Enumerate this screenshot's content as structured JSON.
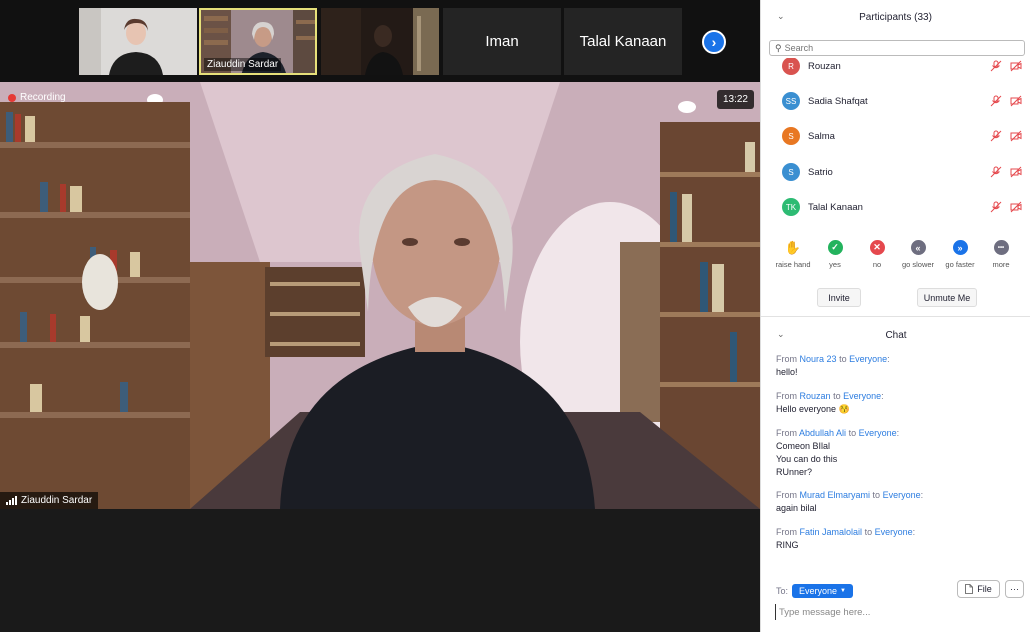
{
  "thumbnails": [
    {
      "name": "",
      "kind": "video-woman"
    },
    {
      "name": "Ziauddin Sardar",
      "kind": "video-man"
    },
    {
      "name": "",
      "kind": "video-dark"
    },
    {
      "name": "Iman",
      "kind": "name-only"
    },
    {
      "name": "Talal Kanaan",
      "kind": "name-only"
    }
  ],
  "main_video": {
    "recording_label": "Recording",
    "timer": "13:22",
    "speaker_name": "Ziauddin Sardar"
  },
  "participants": {
    "title": "Participants (33)",
    "search_placeholder": "Search",
    "items": [
      {
        "initials": "R",
        "name": "Rouzan",
        "color": "#d9534f"
      },
      {
        "initials": "SS",
        "name": "Sadia Shafqat",
        "color": "#3a8fd1"
      },
      {
        "initials": "S",
        "name": "Salma",
        "color": "#e87722"
      },
      {
        "initials": "S",
        "name": "Satrio",
        "color": "#3a8fd1"
      },
      {
        "initials": "TK",
        "name": "Talal Kanaan",
        "color": "#2dbb73"
      }
    ],
    "reactions": [
      {
        "label": "raise hand",
        "symbol": "✋",
        "color": "#1a73e8"
      },
      {
        "label": "yes",
        "symbol": "✓",
        "color": "#23b35d"
      },
      {
        "label": "no",
        "symbol": "✕",
        "color": "#e5484d"
      },
      {
        "label": "go slower",
        "symbol": "«",
        "color": "#6e6e80"
      },
      {
        "label": "go faster",
        "symbol": "»",
        "color": "#1a73e8"
      },
      {
        "label": "more",
        "symbol": "•••",
        "color": "#6e6e80"
      }
    ],
    "invite_label": "Invite",
    "unmute_label": "Unmute Me"
  },
  "chat": {
    "title": "Chat",
    "from_word": "From",
    "to_word": "to",
    "messages": [
      {
        "sender": "Noura 23",
        "recipient": "Everyone",
        "text": [
          "hello!"
        ]
      },
      {
        "sender": "Rouzan",
        "recipient": "Everyone",
        "text": [
          "Hello everyone 😚"
        ]
      },
      {
        "sender": "Abdullah Ali",
        "recipient": "Everyone",
        "text": [
          "Comeon BIlal",
          "You can do this",
          "RUnner?"
        ]
      },
      {
        "sender": "Murad Elmaryami",
        "recipient": "Everyone",
        "text": [
          "again bilal"
        ]
      },
      {
        "sender": "Fatin Jamalolail",
        "recipient": "Everyone",
        "text": [
          "RING"
        ]
      }
    ],
    "to_label": "To:",
    "to_value": "Everyone",
    "file_label": "File",
    "more_label": "···",
    "input_placeholder": "Type message here..."
  }
}
